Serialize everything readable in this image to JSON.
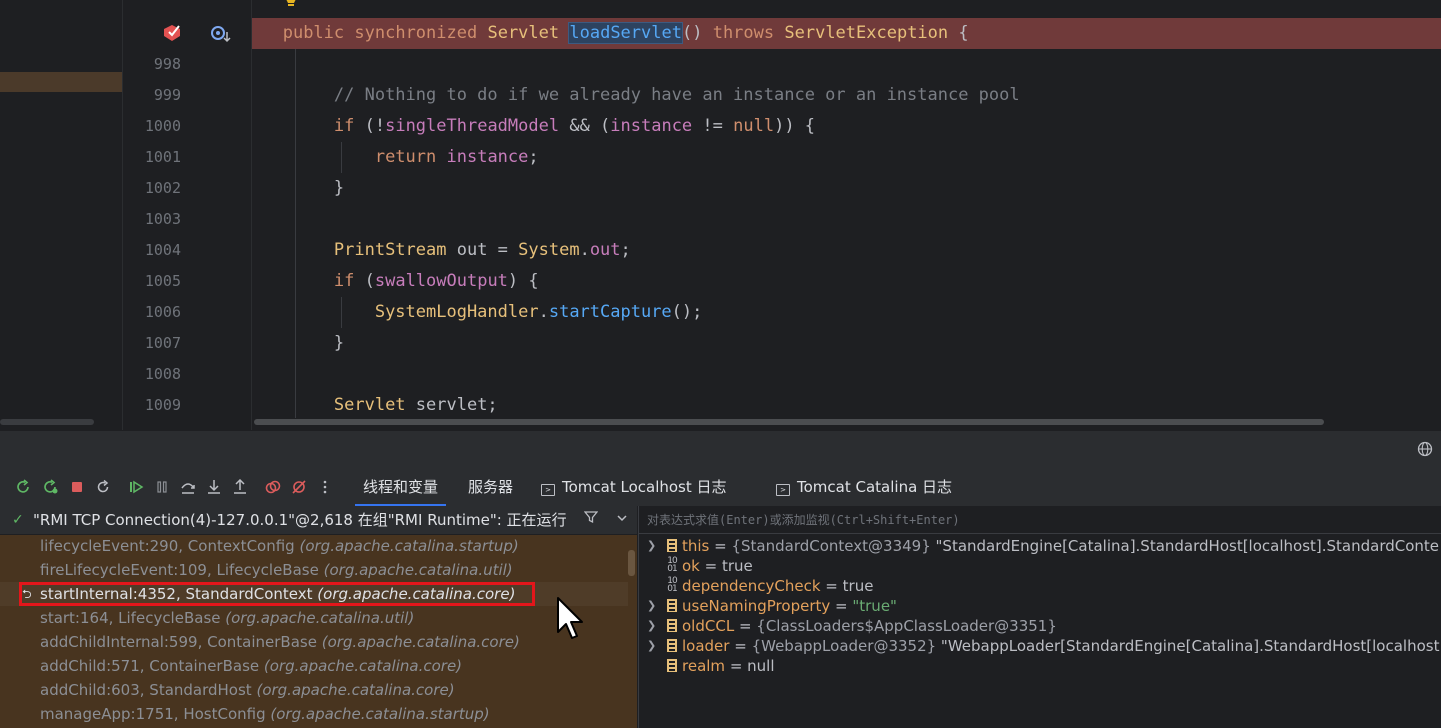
{
  "editor": {
    "line_numbers": [
      "998",
      "999",
      "1000",
      "1001",
      "1002",
      "1003",
      "1004",
      "1005",
      "1006",
      "1007",
      "1008",
      "1009"
    ],
    "breakpoint_line": {
      "kw1": "public",
      "kw2": "synchronized",
      "type": "Servlet",
      "method": "loadServlet",
      "rest": "()",
      "kw3": "throws",
      "exc": "ServletException",
      "brace": "{"
    },
    "comment": "// Nothing to do if we already have an instance or an instance pool",
    "l1000": {
      "kw": "if",
      "p1": " (!",
      "f1": "singleThreadModel",
      "p2": " && (",
      "f2": "instance",
      "p3": " != ",
      "kw2": "null",
      "p4": ")) {"
    },
    "l1001": {
      "kw": "return",
      "f": "instance",
      "p": ";"
    },
    "l1002": "}",
    "l1004": {
      "type": "PrintStream",
      "v": " out = ",
      "cls": "System",
      "dot": ".",
      "f": "out",
      "p": ";"
    },
    "l1005": {
      "kw": "if",
      "p1": " (",
      "f": "swallowOutput",
      "p2": ") {"
    },
    "l1006": {
      "cls": "SystemLogHandler",
      "dot": ".",
      "m": "startCapture",
      "p": "();"
    },
    "l1007": "}",
    "l1009": {
      "type": "Servlet",
      "v": " servlet;"
    }
  },
  "toolbar": {
    "tabs": [
      {
        "label": "线程和变量",
        "active": true
      },
      {
        "label": "服务器"
      },
      {
        "label": "Tomcat Localhost 日志"
      },
      {
        "label": "Tomcat Catalina 日志"
      }
    ]
  },
  "frames": {
    "thread": "\"RMI TCP Connection(4)-127.0.0.1\"@2,618 在组\"RMI Runtime\": 正在运行",
    "items": [
      {
        "method": "lifecycleEvent:290, ContextConfig",
        "pkg": "(org.apache.catalina.startup)"
      },
      {
        "method": "fireLifecycleEvent:109, LifecycleBase",
        "pkg": "(org.apache.catalina.util)"
      },
      {
        "method": "startInternal:4352, StandardContext",
        "pkg": "(org.apache.catalina.core)"
      },
      {
        "method": "start:164, LifecycleBase",
        "pkg": "(org.apache.catalina.util)"
      },
      {
        "method": "addChildInternal:599, ContainerBase",
        "pkg": "(org.apache.catalina.core)"
      },
      {
        "method": "addChild:571, ContainerBase",
        "pkg": "(org.apache.catalina.core)"
      },
      {
        "method": "addChild:603, StandardHost",
        "pkg": "(org.apache.catalina.core)"
      },
      {
        "method": "manageApp:1751, HostConfig",
        "pkg": "(org.apache.catalina.startup)"
      }
    ]
  },
  "variables": {
    "eval_placeholder": "对表达式求值(Enter)或添加监视(Ctrl+Shift+Enter)",
    "items": [
      {
        "name": "this",
        "eq": " = ",
        "obj": "{StandardContext@3349}",
        "val": " \"StandardEngine[Catalina].StandardHost[localhost].StandardConte"
      },
      {
        "name": "ok",
        "eq": " = ",
        "val": "true"
      },
      {
        "name": "dependencyCheck",
        "eq": " = ",
        "val": "true"
      },
      {
        "name": "useNamingProperty",
        "eq": " = ",
        "val": "\"true\""
      },
      {
        "name": "oldCCL",
        "eq": " = ",
        "obj": "{ClassLoaders$AppClassLoader@3351}"
      },
      {
        "name": "loader",
        "eq": " = ",
        "obj": "{WebappLoader@3352}",
        "val": " \"WebappLoader[StandardEngine[Catalina].StandardHost[localhost"
      },
      {
        "name": "realm",
        "eq": " = ",
        "val": "null"
      }
    ]
  }
}
